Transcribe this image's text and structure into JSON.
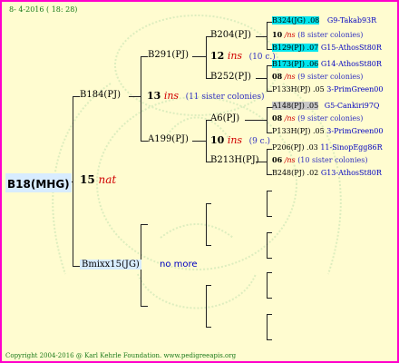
{
  "header": {
    "date": "8- 4-2016 ( 18: 28)"
  },
  "footer": {
    "copyright": "Copyright 2004-2016 @ Karl Kehrle Foundation.   www.pedigreeapis.org"
  },
  "colors": {
    "border": "#ff00cc",
    "background": "#fffcd0",
    "highlight_cyan": "#00e5ee",
    "highlight_grey": "#c8c8c8",
    "accent_red": "#d00000"
  },
  "root": {
    "name": "B18(MHG)",
    "num": "15",
    "tag": "nat"
  },
  "gen1": [
    {
      "name": "B184(PJ)",
      "num": "13",
      "tag": "ins",
      "note": "(11 sister colonies)"
    },
    {
      "name": "Bmixx15(JG)",
      "extra": "no more"
    }
  ],
  "gen2": [
    {
      "name": "B291(PJ)",
      "num": "12",
      "tag": "ins",
      "note": "(10 c.)"
    },
    {
      "name": "A199(PJ)",
      "num": "10",
      "tag": "ins",
      "note": "(9 c.)"
    }
  ],
  "gen3": [
    {
      "name": "B204(PJ)",
      "num": "10",
      "tag": "/ns",
      "note": "(8 sister colonies)"
    },
    {
      "name": "B252(PJ)",
      "num": "08",
      "tag": "/ns",
      "note": "(9 sister colonies)"
    },
    {
      "name": "A6(PJ)",
      "num": "08",
      "tag": "/ns",
      "note": "(9 sister colonies)"
    },
    {
      "name": "B213H(PJ)",
      "num": "06",
      "tag": "/ns",
      "note": "(10 sister colonies)"
    }
  ],
  "gen4": [
    {
      "id": "B324(JG)",
      "yr": ".08",
      "code": "G9",
      "line": "-Takab93R"
    },
    {
      "id": "B129(PJ)",
      "yr": ".07",
      "code": "G15",
      "line": "-AthosSt80R"
    },
    {
      "id": "B173(PJ)",
      "yr": ".06",
      "code": "G14",
      "line": "-AthosSt80R"
    },
    {
      "id": "P133H(PJ)",
      "yr": ".05",
      "code": "3",
      "line": "-PrimGreen00"
    },
    {
      "id": "A148(PJ)",
      "yr": ".05",
      "code": "G5",
      "line": "-Cankiri97Q"
    },
    {
      "id": "P133H(PJ)",
      "yr": ".05",
      "code": "3",
      "line": "-PrimGreen00"
    },
    {
      "id": "P206(PJ)",
      "yr": ".03",
      "code": "11",
      "line": "-SinopEgg86R"
    },
    {
      "id": "B248(PJ)",
      "yr": ".02",
      "code": "G13",
      "line": "-AthosSt80R"
    }
  ]
}
